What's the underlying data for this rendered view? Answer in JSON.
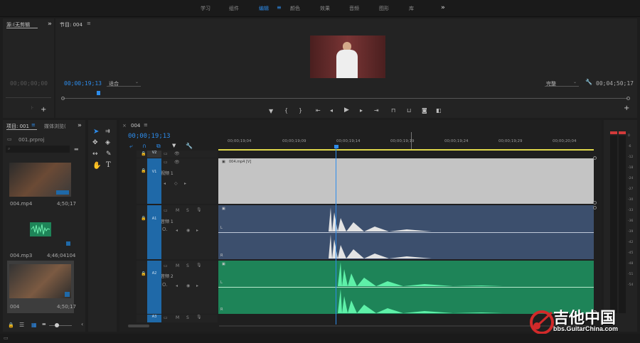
{
  "workspaces": [
    "学习",
    "组件",
    "编辑",
    "颜色",
    "效果",
    "音频",
    "图形",
    "库"
  ],
  "active_workspace": "编辑",
  "source": {
    "title": "源:(无剪辑",
    "timecode": "00;00;00;00"
  },
  "program": {
    "title": "节目: 004",
    "timecode": "00;00;19;13",
    "fit": "适合",
    "quality": "完整",
    "duration": "00;04;50;17"
  },
  "project": {
    "tab_project": "项目: 001",
    "tab_media": "媒体浏览(",
    "file": "001.prproj",
    "items": [
      {
        "name": "004.mp4",
        "duration": "4;50;17"
      },
      {
        "name": "004.mp3",
        "duration": "4;46;04104"
      },
      {
        "name": "004",
        "duration": "4;50;17"
      }
    ]
  },
  "timeline": {
    "sequence": "004",
    "timecode": "00;00;19;13",
    "ruler": [
      "00;00;19;04",
      "00;00;19;09",
      "00;00;19;14",
      "00;00;19;19",
      "00;00;19;24",
      "00;00;19;29",
      "00;00;20;04"
    ],
    "tracks": {
      "v2": "V2",
      "v1": "V1",
      "v1_name": "视频 1",
      "a1": "A1",
      "a1_name": "音频 1",
      "a2": "A2",
      "a2_name": "音频 2",
      "a3": "A3"
    },
    "clip_video": "004.mp4 [V]",
    "channel_l": "L",
    "channel_r": "R"
  },
  "meter_scale": [
    "0",
    "-6",
    "-12",
    "-18",
    "-24",
    "-27",
    "-30",
    "-33",
    "-36",
    "-39",
    "-42",
    "-45",
    "-48",
    "-51",
    "-54"
  ],
  "watermark": {
    "title": "吉他中国",
    "url": "bbs.GuitarChina.com"
  },
  "colors": {
    "accent": "#2d8ceb",
    "audio1": "#3c4f6d",
    "audio2": "#1e8458",
    "video_clip": "#c4c4c4",
    "track_tag": "#1f69a8"
  }
}
